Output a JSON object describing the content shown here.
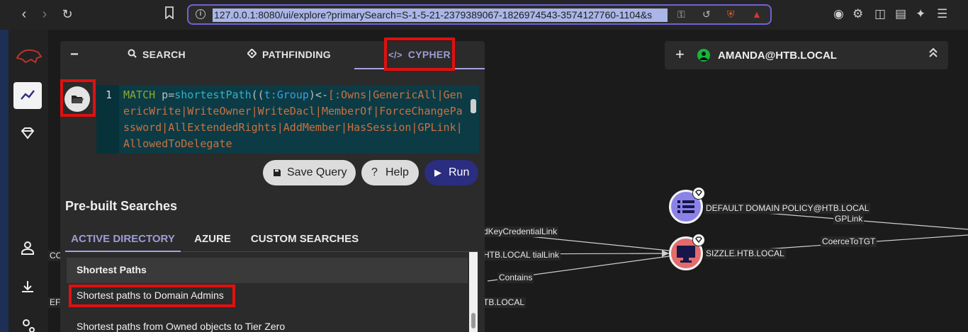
{
  "browser": {
    "url": "127.0.0.1:8080/ui/explore?primarySearch=S-1-5-21-2379389067-1826974543-3574127760-1104&s"
  },
  "search_panel": {
    "tabs": [
      {
        "label": "SEARCH",
        "icon": "search-icon"
      },
      {
        "label": "PATHFINDING",
        "icon": "diamond-icon"
      },
      {
        "label": "CYPHER",
        "icon": "code-icon",
        "active": true
      }
    ],
    "editor": {
      "line_number": "1",
      "tokens": {
        "t1": "MATCH",
        "t2": " p=",
        "t3": "shortestPath",
        "t4": "((",
        "t5": "t:Group",
        "t6": ")<-",
        "t7": "[:Owns|GenericAll|GenericWrite|WriteOwner|WriteDacl|MemberOf|ForceChangePassword|AllExtendedRights|AddMember|HasSession|GPLink|AllowedToDelegate"
      }
    },
    "buttons": {
      "save": "Save Query",
      "help": "Help",
      "run": "Run"
    },
    "prebuilt_title": "Pre-built Searches",
    "search_tabs": [
      {
        "label": "ACTIVE DIRECTORY",
        "active": true
      },
      {
        "label": "AZURE"
      },
      {
        "label": "CUSTOM SEARCHES"
      }
    ],
    "list": {
      "header": "Shortest Paths",
      "items": [
        "Shortest paths to Domain Admins",
        "Shortest paths from Owned objects to Tier Zero"
      ]
    }
  },
  "entity_panel": {
    "name": "AMANDA@HTB.LOCAL"
  },
  "graph": {
    "nodes": [
      {
        "label": "DEFAULT DOMAIN POLICY@HTB.LOCAL",
        "color": "#8b82e8",
        "icon": "list-icon"
      },
      {
        "label": "SIZZLE.HTB.LOCAL",
        "color": "#e36b6b",
        "icon": "computer-icon"
      }
    ],
    "edge_labels": {
      "e1": "dKeyCredentialLink",
      "e2": "HTB.LOCAL tialLink",
      "e3": "Contains",
      "e4": "GPLink",
      "e5": "CoerceToTGT",
      "e6": "TB.LOCAL",
      "e7": "CC",
      "e8": "EFA"
    }
  },
  "colors": {
    "accent": "#a5a2e0",
    "run_button": "#2b2d80",
    "highlight": "#e01010",
    "editor_bg": "#0c3b45"
  }
}
